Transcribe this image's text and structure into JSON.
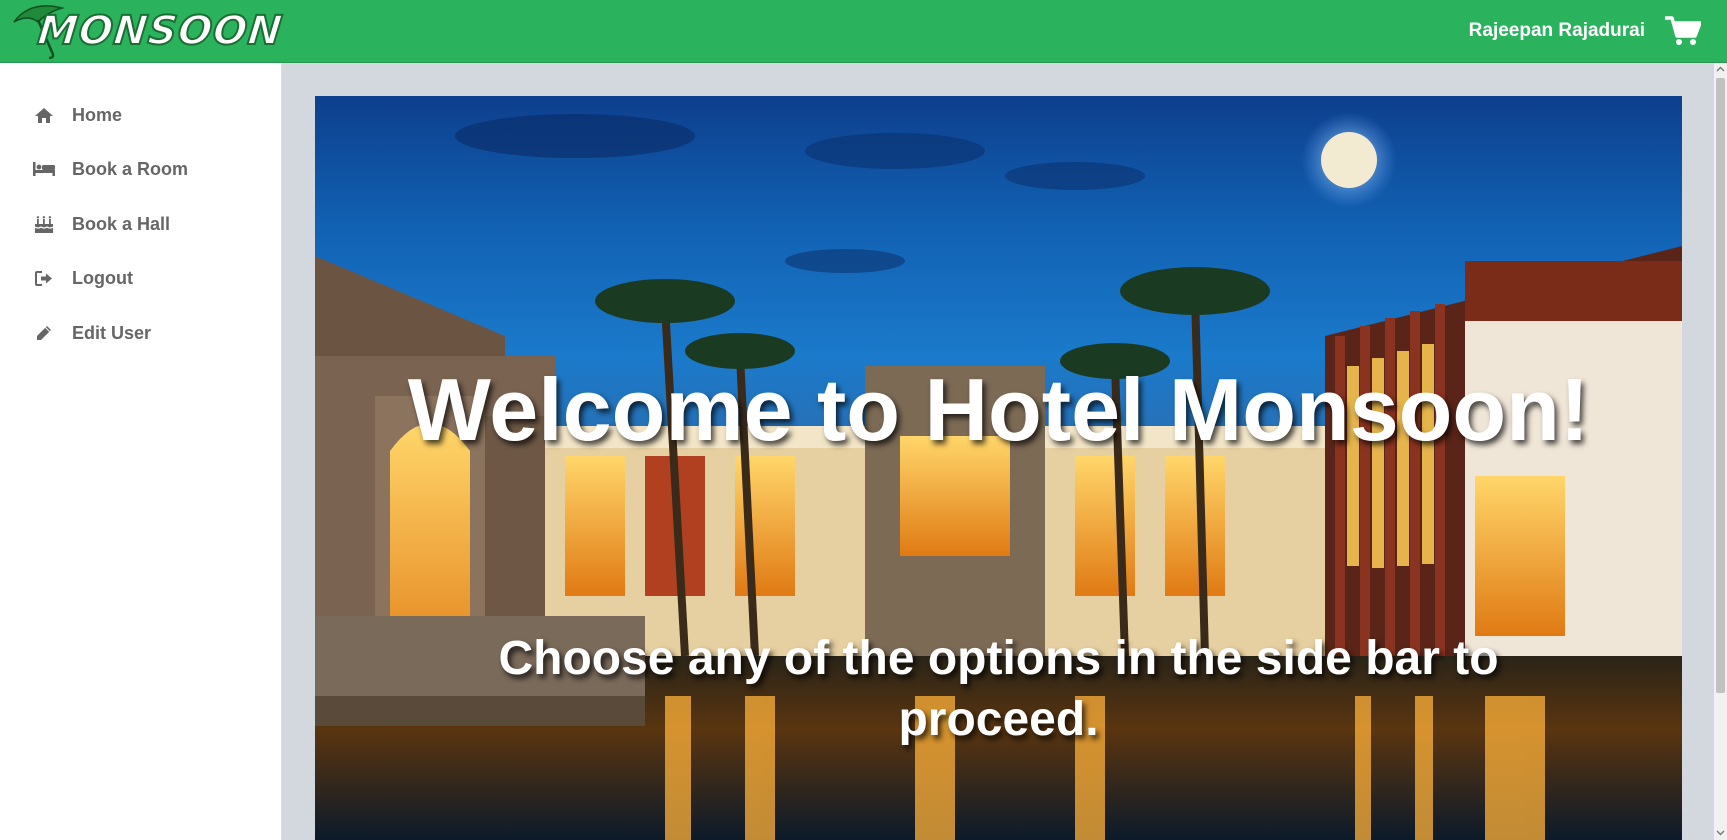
{
  "app": {
    "brand": "MONSOON",
    "user_name": "Rajeepan Rajadurai"
  },
  "colors": {
    "header_bg": "#2ab25d",
    "sidebar_bg": "#ffffff",
    "content_bg": "#d2d8de",
    "menu_text": "#666666"
  },
  "sidebar": {
    "items": [
      {
        "label": "Home",
        "icon": "home-icon"
      },
      {
        "label": "Book a Room",
        "icon": "bed-icon"
      },
      {
        "label": "Book a Hall",
        "icon": "birthday-cake-icon"
      },
      {
        "label": "Logout",
        "icon": "sign-out-icon"
      },
      {
        "label": "Edit User",
        "icon": "pencil-icon"
      }
    ]
  },
  "main": {
    "welcome_title": "Welcome to Hotel Monsoon!",
    "subtitle": "Choose any of the options in the side bar to proceed."
  }
}
